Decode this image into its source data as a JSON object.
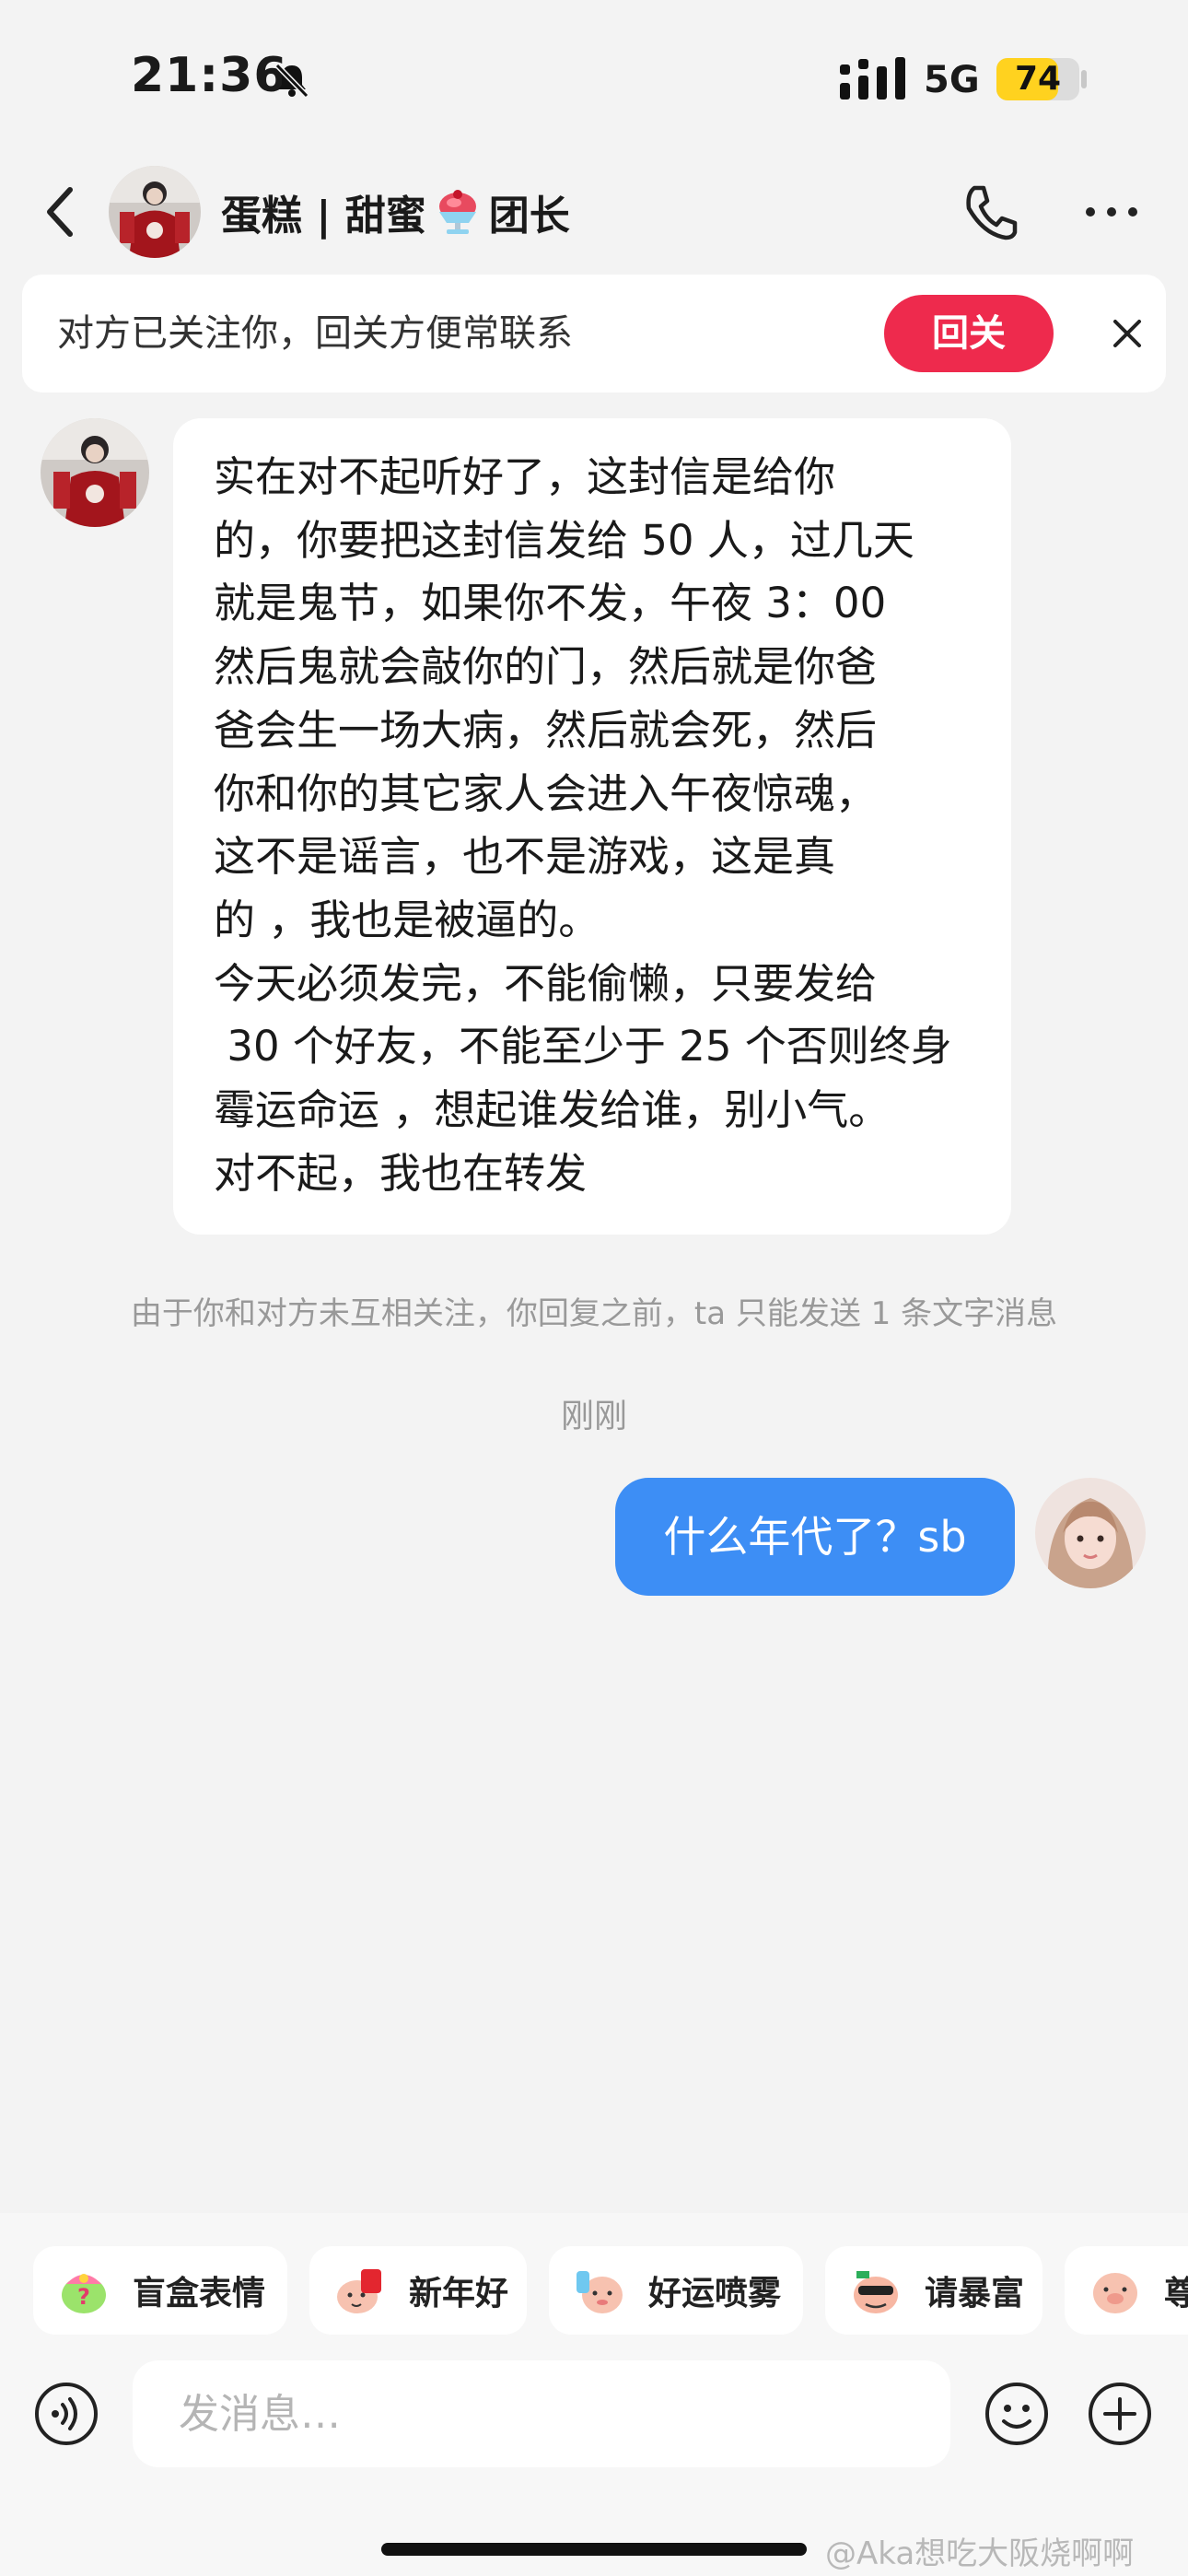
{
  "status_bar": {
    "time": "21:36",
    "network": "5G",
    "battery": "74",
    "battery_level": 0.74
  },
  "header": {
    "name_part1": "蛋糕 | 甜蜜",
    "name_part2": "团长",
    "icons": [
      "back-arrow-icon",
      "ice-cream-icon",
      "phone-icon",
      "more-icon"
    ]
  },
  "banner": {
    "text": "对方已关注你，回关方便常联系",
    "button": "回关"
  },
  "messages": {
    "incoming_text": "实在对不起听好了，这封信是给你\n的，你要把这封信发给 50 人，过几天\n就是鬼节，如果你不发，午夜 3：00\n然后鬼就会敲你的门，然后就是你爸\n爸会生一场大病，然后就会死，然后\n你和你的其它家人会进入午夜惊魂，\n这不是谣言，也不是游戏，这是真\n的 ，我也是被逼的。\n今天必须发完，不能偷懒，只要发给\n 30 个好友，不能至少于 25 个否则终身\n霉运命运 ，想起谁发给谁，别小气。\n对不起，我也在转发",
    "notice": "由于你和对方未互相关注，你回复之前，ta 只能发送 1 条文字消息",
    "timestamp": "刚刚",
    "outgoing_text": "什么年代了？sb"
  },
  "stickers": [
    {
      "label": "盲盒表情",
      "icon": "blind-box-sticker-icon"
    },
    {
      "label": "新年好",
      "icon": "new-year-sticker-icon"
    },
    {
      "label": "好运喷雾",
      "icon": "good-luck-spray-sticker-icon"
    },
    {
      "label": "请暴富",
      "icon": "get-rich-sticker-icon"
    },
    {
      "label": "尊",
      "icon": "pig-sticker-icon"
    }
  ],
  "composer": {
    "placeholder": "发消息…",
    "icons": [
      "voice-icon",
      "emoji-icon",
      "plus-icon"
    ]
  },
  "watermark": "@Aka想吃大阪烧啊啊",
  "colors": {
    "follow_button": "#ee2a4d",
    "outgoing_bubble": "#3d8ef5",
    "battery": "#ffd21f",
    "background": "#f3f3f3"
  }
}
